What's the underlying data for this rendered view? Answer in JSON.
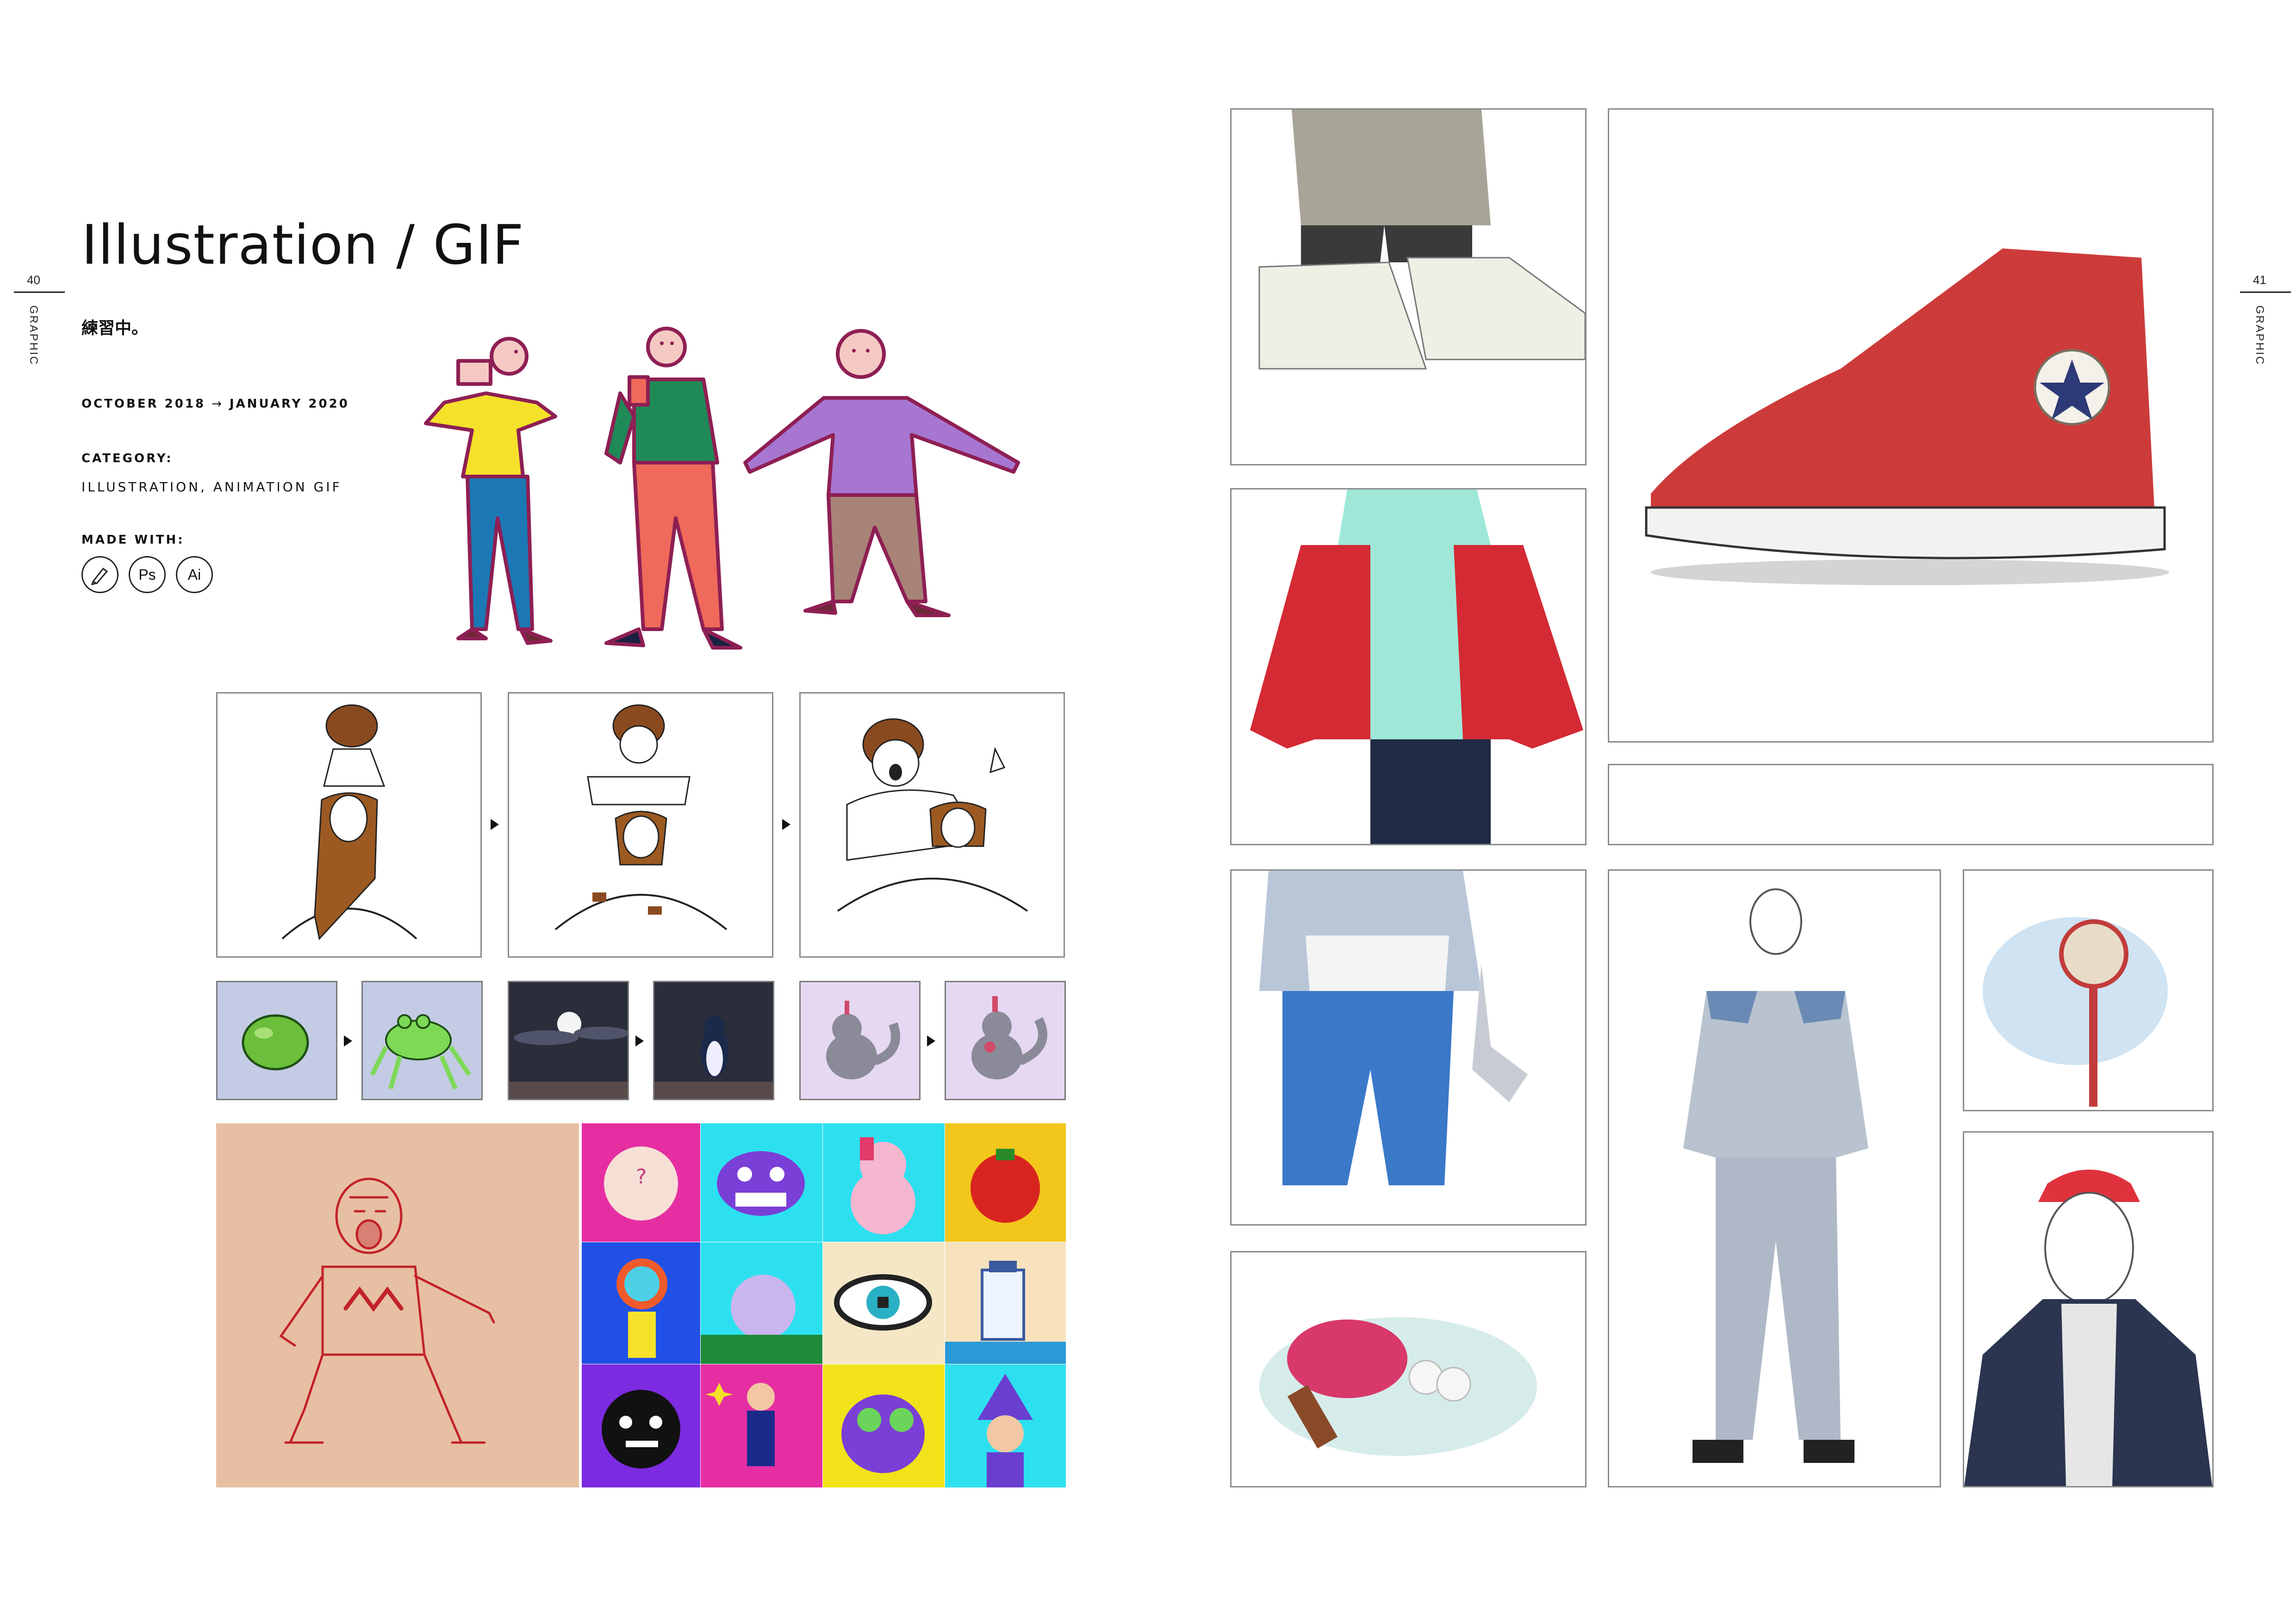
{
  "page_left": {
    "number": "40",
    "section": "GRAPHIC"
  },
  "page_right": {
    "number": "41",
    "section": "GRAPHIC"
  },
  "title": "Illustration / GIF",
  "subtitle": "練習中。",
  "period": {
    "start": "OCTOBER 2018",
    "arrow": "→",
    "end": "JANUARY 2020"
  },
  "category": {
    "label": "CATEGORY:",
    "value": "ILLUSTRATION, ANIMATION GIF"
  },
  "made_with": {
    "label": "MADE WITH:",
    "tools": [
      "pen-tool-icon",
      "Ps",
      "Ai"
    ]
  },
  "colors": {
    "yellow": "#f5e12a",
    "green": "#1f8a57",
    "purple": "#a776d1",
    "blue": "#1b78b4",
    "coral": "#ef6a5a",
    "taupe": "#a88377",
    "outline": "#8e1f54",
    "peach": "#e7bfa3",
    "red_shoe": "#cc3b3a",
    "lavender": "#e6d8f2",
    "periwinkle": "#c4cbe4",
    "night": "#2a2d3a"
  },
  "tiles": {
    "top_left_glyph": "?"
  }
}
